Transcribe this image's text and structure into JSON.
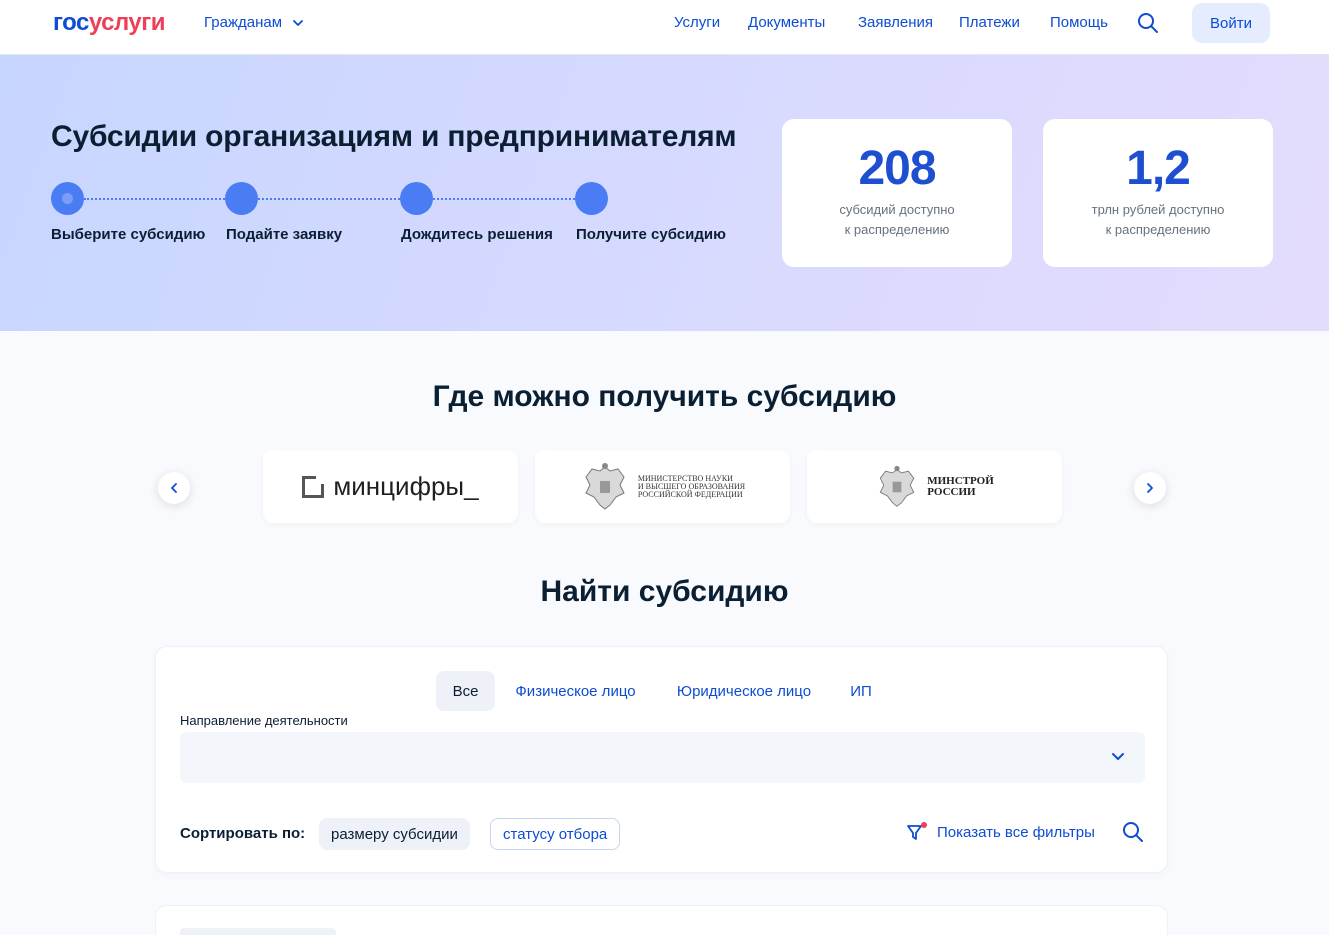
{
  "header": {
    "logo_gos": "гос",
    "logo_uslugi": "услуги",
    "audience": "Гражданам",
    "nav": [
      "Услуги",
      "Документы",
      "Заявления",
      "Платежи",
      "Помощь"
    ],
    "login": "Войти",
    "icons": {
      "audience_dropdown": "chevron-down-icon",
      "search": "search-icon"
    }
  },
  "hero": {
    "title": "Субсидии организациям и предпринимателям",
    "steps": [
      "Выберите субсидию",
      "Подайте заявку",
      "Дождитесь решения",
      "Получите субсидию"
    ],
    "stats": [
      {
        "value": "208",
        "text_line1": "субсидий доступно",
        "text_line2": "к распределению"
      },
      {
        "value": "1,2",
        "text_line1": "трлн рублей доступно",
        "text_line2": "к распределению"
      }
    ]
  },
  "where": {
    "title": "Где можно получить субсидию",
    "logos": [
      {
        "name": "минцифры_"
      },
      {
        "line1": "Министерство науки",
        "line2": "и высшего образования",
        "line3": "Российской Федерации"
      },
      {
        "line1": "МИНСТРОЙ",
        "line2": "РОССИИ"
      }
    ]
  },
  "find": {
    "title": "Найти субсидию",
    "tabs": [
      "Все",
      "Физическое лицо",
      "Юридическое лицо",
      "ИП"
    ],
    "active_tab": "Все",
    "direction_label": "Направление деятельности",
    "direction_value": "",
    "sort_label": "Сортировать по:",
    "sort_options": [
      "размеру субсидии",
      "статусу отбора"
    ],
    "show_filters": "Показать все фильтры"
  },
  "colors": {
    "brand_blue": "#0d4cd3",
    "brand_red": "#ee3f58",
    "step_blue": "#4a7df4",
    "stat_blue": "#1f4fd1"
  }
}
